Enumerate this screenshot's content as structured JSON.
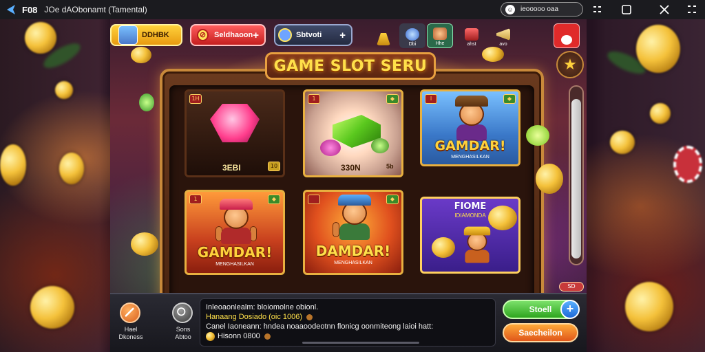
{
  "window": {
    "app_code": "F08",
    "title": "JOe dAObonamt (Tamental)",
    "pill_label": "ieooooo oaa",
    "controls": [
      "minimize",
      "restore",
      "close",
      "more"
    ]
  },
  "header": {
    "player_label": "DDHBK",
    "balance_label": "Seldhaoon",
    "secondary_label": "Sbtvoti",
    "nav_items": [
      {
        "label": "",
        "icon": "chest-icon"
      },
      {
        "label": "Dbi",
        "icon": "globe-icon"
      },
      {
        "label": "Hhe",
        "icon": "avatar-icon"
      },
      {
        "label": "ahst",
        "icon": "gift-icon"
      },
      {
        "label": "avo",
        "icon": "horn-icon"
      },
      {
        "label": "",
        "icon": "chat-icon"
      }
    ]
  },
  "title_banner": "GAME SLOT SERU",
  "tiles": [
    {
      "badge": "1H",
      "price": "3EBI",
      "extra": "10"
    },
    {
      "badge": "1",
      "price": "330N",
      "extra": "5b"
    },
    {
      "badge": "I",
      "name": "GAMDAR!",
      "sub": "MENGHASILKAN"
    },
    {
      "badge": "1",
      "name": "GAMDAR!",
      "sub": "MENGHASILKAN"
    },
    {
      "badge": "",
      "name": "DAMDAR!",
      "sub": "MENGHASILKAN"
    },
    {
      "title": "FIOME",
      "sub": "IDIAMONDA"
    }
  ],
  "side": {
    "mini_tag": "SD"
  },
  "bottom": {
    "left_button": {
      "label_line1": "Hael",
      "label_line2": "Dkoness"
    },
    "mid_button": {
      "label_line1": "Sons",
      "label_line2": "Abtoo"
    },
    "chat": [
      {
        "text": "Inleoaonlealm: bloiomolne obionl.",
        "highlight": false
      },
      {
        "text": "Hanaang Dosiado (oic 1006)",
        "highlight": true
      },
      {
        "text": "Canel Iaoneann: hndea noaaoodeotnn flonicg oonmiteong laioi hatt:",
        "highlight": false
      },
      {
        "text": "Hisonn 0800",
        "highlight": false
      }
    ],
    "start_label": "Stoell",
    "cancel_label": "Saecheilon"
  },
  "colors": {
    "gold": "#ffd23c",
    "green_button": "#2ea51e",
    "orange_button": "#e0561a",
    "red_button": "#c41e1e"
  }
}
